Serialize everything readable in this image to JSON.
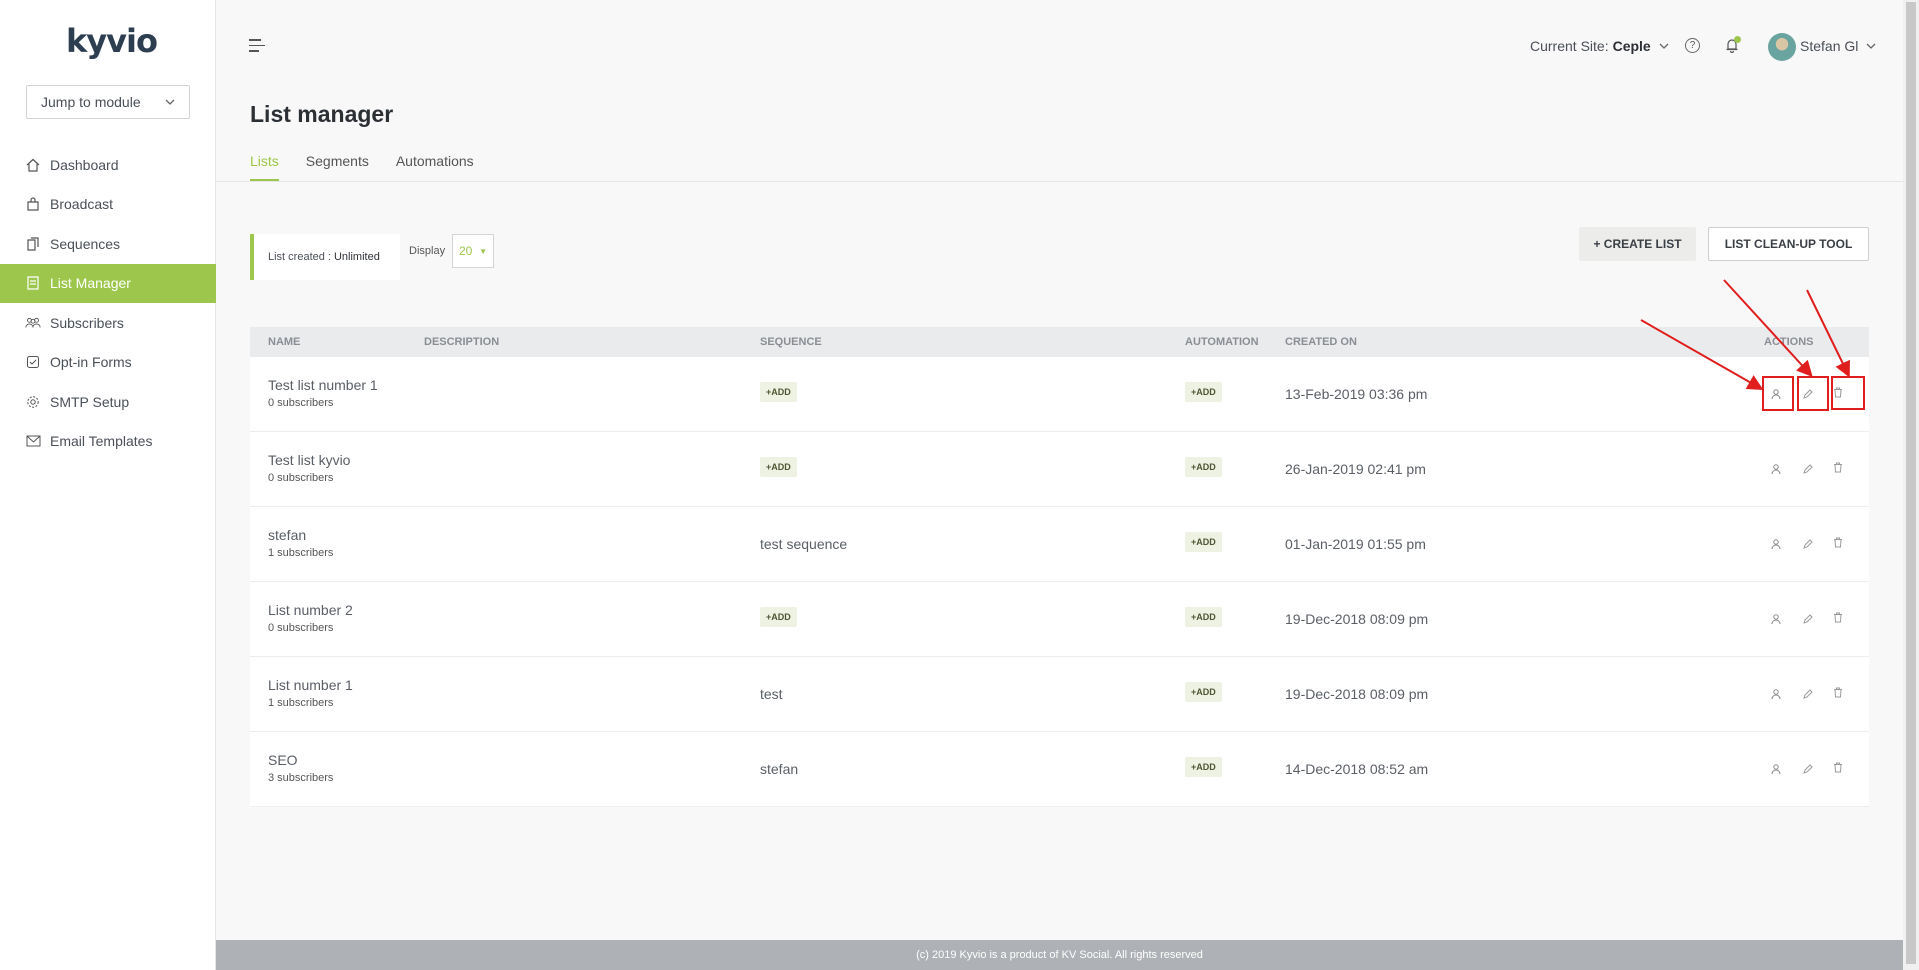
{
  "logo": {
    "text": "kyvio"
  },
  "sidebar": {
    "jump_label": "Jump to module",
    "items": [
      {
        "label": "Dashboard",
        "icon": "home-icon"
      },
      {
        "label": "Broadcast",
        "icon": "bag-icon"
      },
      {
        "label": "Sequences",
        "icon": "copy-icon"
      },
      {
        "label": "List Manager",
        "icon": "list-icon",
        "active": true
      },
      {
        "label": "Subscribers",
        "icon": "users-icon"
      },
      {
        "label": "Opt-in Forms",
        "icon": "checkbox-icon"
      },
      {
        "label": "SMTP Setup",
        "icon": "gear-icon"
      },
      {
        "label": "Email Templates",
        "icon": "mail-icon"
      }
    ]
  },
  "header": {
    "site_label": "Current Site:",
    "site_value": "Ceple",
    "user_name": "Stefan Gl"
  },
  "page": {
    "title": "List manager",
    "tabs": [
      "Lists",
      "Segments",
      "Automations"
    ]
  },
  "toolbar": {
    "list_created_label": "List created :",
    "list_created_value": "Unlimited",
    "display_label": "Display",
    "display_value": "20",
    "create_button": "+ CREATE LIST",
    "cleanup_button": "LIST CLEAN-UP TOOL"
  },
  "table": {
    "headers": {
      "name": "NAME",
      "description": "DESCRIPTION",
      "sequence": "SEQUENCE",
      "automation": "AUTOMATION",
      "created": "CREATED ON",
      "actions": "ACTIONS"
    },
    "add_label": "+ADD",
    "rows": [
      {
        "name": "Test list number 1",
        "subs": "0 subscribers",
        "sequence": "",
        "created": "13-Feb-2019 03:36 pm"
      },
      {
        "name": "Test list kyvio",
        "subs": "0 subscribers",
        "sequence": "",
        "created": "26-Jan-2019 02:41 pm"
      },
      {
        "name": "stefan",
        "subs": "1 subscribers",
        "sequence": "test sequence",
        "created": "01-Jan-2019 01:55 pm"
      },
      {
        "name": "List number 2",
        "subs": "0 subscribers",
        "sequence": "",
        "created": "19-Dec-2018 08:09 pm"
      },
      {
        "name": "List number 1",
        "subs": "1 subscribers",
        "sequence": "test",
        "created": "19-Dec-2018 08:09 pm"
      },
      {
        "name": "SEO",
        "subs": "3 subscribers",
        "sequence": "stefan",
        "created": "14-Dec-2018 08:52 am"
      }
    ]
  },
  "footer": {
    "text": "(c) 2019 Kyvio is a product of KV Social. All rights reserved"
  },
  "colors": {
    "accent": "#9dc74c",
    "annotation": "#e01e1e"
  }
}
